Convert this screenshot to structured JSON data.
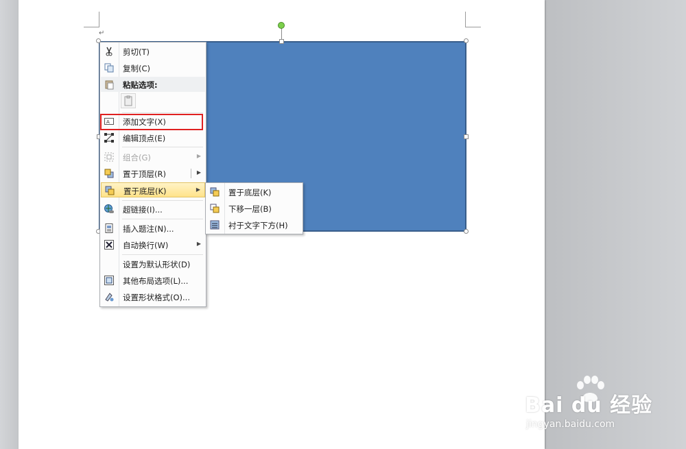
{
  "document": {
    "paragraph_mark": "↵"
  },
  "shape": {
    "fill_color": "#4f81bd",
    "border_color": "#385d8a"
  },
  "context_menu": {
    "items": [
      {
        "label": "剪切(T)",
        "icon": "scissors-icon"
      },
      {
        "label": "复制(C)",
        "icon": "copy-icon"
      },
      {
        "label": "粘贴选项:",
        "icon": "paste-icon",
        "header": true
      },
      {
        "label": "添加文字(X)",
        "icon": "text-box-icon",
        "highlighted_annotation": true
      },
      {
        "label": "编辑顶点(E)",
        "icon": "edit-points-icon"
      },
      {
        "label": "组合(G)",
        "icon": "group-icon",
        "disabled": true
      },
      {
        "label": "置于顶层(R)",
        "icon": "bring-to-front-icon"
      },
      {
        "label": "置于底层(K)",
        "icon": "send-to-back-icon",
        "active": true
      },
      {
        "label": "超链接(I)...",
        "icon": "hyperlink-icon"
      },
      {
        "label": "插入题注(N)...",
        "icon": "caption-icon"
      },
      {
        "label": "自动换行(W)",
        "icon": "wrap-text-icon"
      },
      {
        "label": "设置为默认形状(D)",
        "icon": ""
      },
      {
        "label": "其他布局选项(L)...",
        "icon": "layout-options-icon"
      },
      {
        "label": "设置形状格式(O)...",
        "icon": "format-shape-icon"
      }
    ]
  },
  "submenu": {
    "items": [
      {
        "label": "置于底层(K)",
        "icon": "send-to-back-icon"
      },
      {
        "label": "下移一层(B)",
        "icon": "send-backward-icon"
      },
      {
        "label": "衬于文字下方(H)",
        "icon": "behind-text-icon"
      }
    ]
  },
  "watermark": {
    "brand": "Bai du 经验",
    "url": "jingyan.baidu.com"
  },
  "colors": {
    "highlight_border": "#e02020",
    "menu_active": "#ffe38a"
  }
}
